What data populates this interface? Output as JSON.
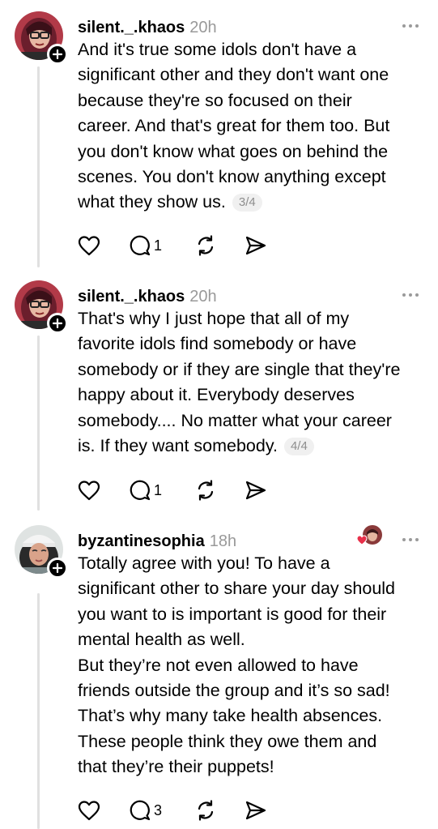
{
  "posts": [
    {
      "username": "silent._.khaos",
      "time": "20h",
      "lines": [
        "And it's true some idols don't have a",
        "significant other and they don't want one",
        "because they're so focused on their",
        "career. And that's great for them too. But",
        "you don't know what goes on behind the",
        "scenes. You don't know anything except",
        "what they show us."
      ],
      "pager": "3/4",
      "reply_count": "1"
    },
    {
      "username": "silent._.khaos",
      "time": "20h",
      "lines": [
        "That's why I just hope that all of my",
        "favorite idols find somebody or have",
        "somebody or if they are single that they're",
        "happy about it. Everybody deserves",
        "somebody.... No matter what your career",
        "is. If they want somebody."
      ],
      "pager": "4/4",
      "reply_count": "1"
    },
    {
      "username": "byzantinesophia",
      "time": "18h",
      "lines": [
        "Totally agree with you! To have a",
        "significant other to share your day should",
        "you want to is important is good for their",
        "mental health as well.",
        "But they’re not even allowed to have",
        "friends outside the group and it’s so sad!",
        "That’s why many take health absences.",
        "These people think they owe them and",
        "that they’re their puppets!"
      ],
      "reply_count": "3"
    }
  ],
  "colors": {
    "text": "#000000",
    "secondary": "#999999",
    "thread_line": "#e0e0e0",
    "like_heart": "#e8304a"
  },
  "icons": {
    "like": "heart-outline-icon",
    "reply": "comment-bubble-icon",
    "repost": "repost-arrows-icon",
    "share": "send-arrow-icon",
    "follow": "plus-icon",
    "more": "more-dots-icon"
  }
}
